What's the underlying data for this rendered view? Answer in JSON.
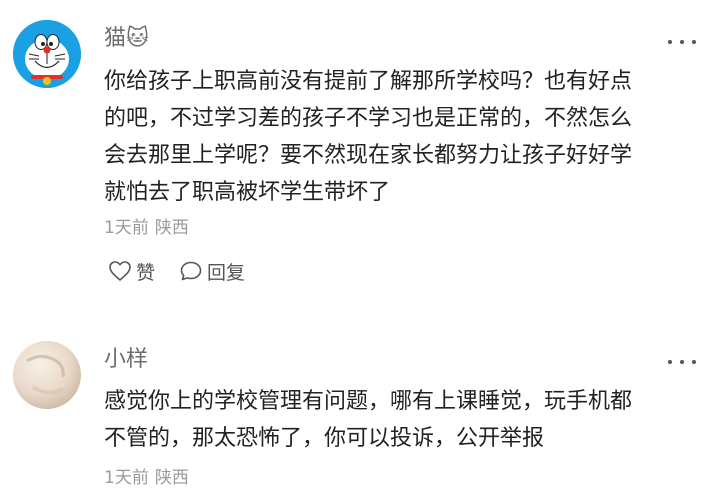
{
  "comments": [
    {
      "username": "猫",
      "username_emoji": "🐱",
      "text": "你给孩子上职高前没有提前了解那所学校吗？也有好点\n的吧，不过学习差的孩子不学习也是正常的，不然怎么\n会去那里上学呢？要不然现在家长都努力让孩子好好学\n就怕去了职高被坏学生带坏了",
      "time": "1天前",
      "location": "陕西",
      "like_label": "赞",
      "reply_label": "回复",
      "avatar_icon": "doraemon-avatar"
    },
    {
      "username": "小样",
      "text": "感觉你上的学校管理有问题，哪有上课睡觉，玩手机都\n不管的，那太恐怖了，你可以投诉，公开举报",
      "time": "1天前",
      "location": "陕西",
      "avatar_icon": "photo-avatar"
    }
  ],
  "colors": {
    "username": "#6d6d6d",
    "body_text": "#222222",
    "meta_text": "#9a9a9a",
    "doraemon_blue": "#1aa0e3"
  }
}
